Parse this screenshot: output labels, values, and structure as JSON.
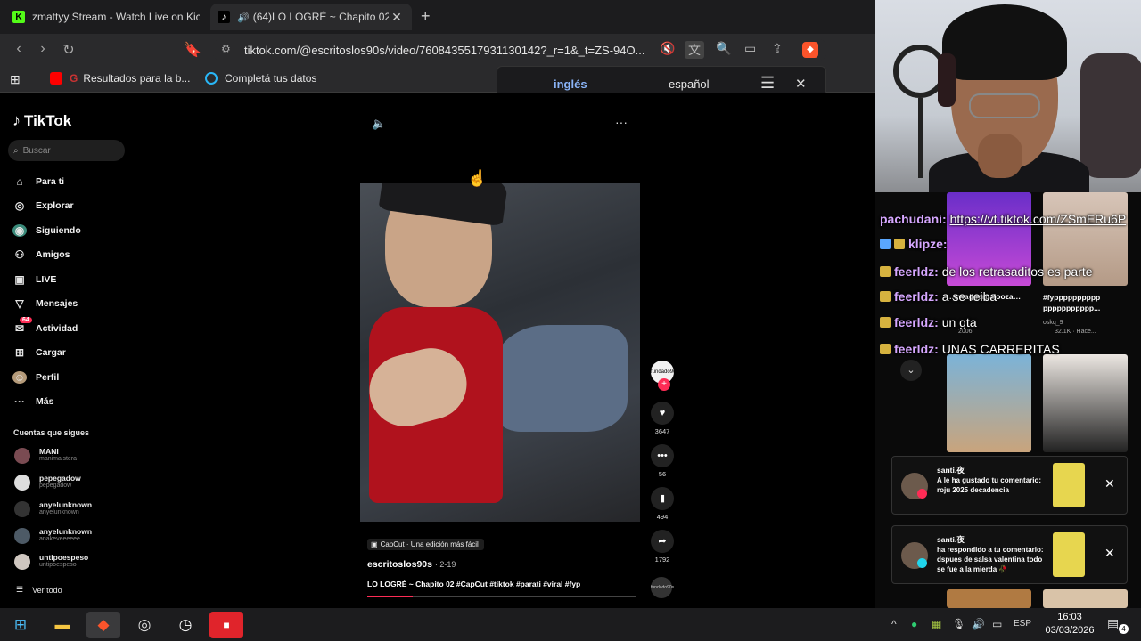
{
  "browser": {
    "tabs": [
      {
        "title": "zmattyy Stream - Watch Live on Kick",
        "favicon": "kick-icon",
        "active": false
      },
      {
        "title": "(64)LO LOGRÉ ~ Chapito 02 #",
        "favicon": "tiktok-icon",
        "active": true
      }
    ],
    "new_tab": "+",
    "url": "tiktok.com/@escritoslos90s/video/7608435517931130142?_r=1&_t=ZS-94O...",
    "bookmarks": [
      {
        "label": "Resultados para la b...",
        "icon": "youtube-icon"
      },
      {
        "label": "Completá tus datos",
        "icon": "circle-icon"
      }
    ],
    "brave_badge": "6"
  },
  "translate": {
    "lang_from": "inglés",
    "lang_to": "español"
  },
  "tiktok": {
    "logo": "TikTok",
    "search_placeholder": "Buscar",
    "nav": [
      {
        "label": "Para ti",
        "icon": "home-icon"
      },
      {
        "label": "Explorar",
        "icon": "compass-icon"
      },
      {
        "label": "Siguiendo",
        "icon": "following-icon"
      },
      {
        "label": "Amigos",
        "icon": "friends-icon"
      },
      {
        "label": "LIVE",
        "icon": "live-icon"
      },
      {
        "label": "Mensajes",
        "icon": "messages-icon"
      },
      {
        "label": "Actividad",
        "icon": "activity-icon",
        "badge": "64"
      },
      {
        "label": "Cargar",
        "icon": "upload-icon"
      },
      {
        "label": "Perfil",
        "icon": "profile-icon"
      },
      {
        "label": "Más",
        "icon": "more-icon"
      }
    ],
    "following_title": "Cuentas que sigues",
    "following": [
      {
        "name": "MANI",
        "handle": "manimaistera"
      },
      {
        "name": "pepegadow",
        "handle": "pepegadow"
      },
      {
        "name": "anyelunknown",
        "handle": "anyelunknown"
      },
      {
        "name": "anyelunknown",
        "handle": "anakeveeeeee"
      },
      {
        "name": "untipoespeso",
        "handle": "untipoespeso"
      }
    ],
    "see_all": "Ver todo",
    "video": {
      "capcut": "CapCut · Una edición más fácil",
      "author": "escritoslos90s",
      "date": "· 2-19",
      "description": "LO LOGRÉ ~ Chapito 02 #CapCut #tiktok #parati #viral #fyp",
      "progress": 0.17,
      "likes": "3647",
      "comments": "56",
      "saves": "494",
      "shares": "1792",
      "avatar_text": "fundado90s"
    }
  },
  "chat": {
    "lines": [
      {
        "user": "pachudani:",
        "msg": "https://vt.tiktok.com/ZSmERu6P",
        "is_link": true,
        "icon": "none"
      },
      {
        "user": "klipze:",
        "msg": "",
        "icon": "blue"
      },
      {
        "user": "feerldz:",
        "msg": "de los retrasaditos es parte",
        "icon": "gold"
      },
      {
        "user": "feerldz:",
        "msg": "a se reiba",
        "icon": "gold"
      },
      {
        "user": "feerldz:",
        "msg": "un gta",
        "icon": "gold"
      },
      {
        "user": "feerldz:",
        "msg": "UNAS CARRERITAS",
        "icon": "gold"
      }
    ],
    "thumbs": [
      {
        "caption": "…swaggerpalooza…",
        "meta": "2006"
      },
      {
        "caption": "#fypppppppppp ppppppppppp...",
        "meta": "32.1K · Hace..."
      },
      {
        "caption": "",
        "meta": "oskq_9"
      }
    ]
  },
  "notifications": [
    {
      "user": "santi.夜",
      "text": "A le ha gustado tu comentario: roju 2025 decadencia",
      "dot_color": "#fe2c55"
    },
    {
      "user": "santi.夜",
      "text": "ha respondido a tu comentario: dspues de salsa valentina todo se fue a la mierda 🥀",
      "dot_color": "#20d5ec"
    }
  ],
  "taskbar": {
    "lang": "ESP",
    "time": "16:03",
    "date": "03/03/2026",
    "notif_count": "4"
  }
}
